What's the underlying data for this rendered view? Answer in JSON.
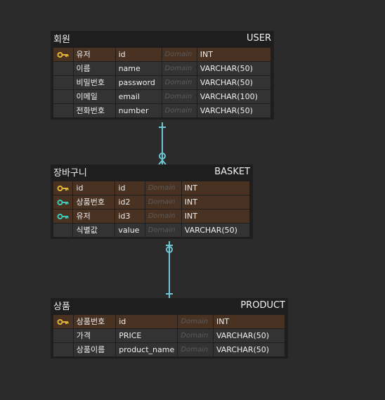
{
  "colors": {
    "pk_key": "#e5b53a",
    "fk_key": "#3ec9b8",
    "relation_line": "#6fc6d3"
  },
  "entities": {
    "user": {
      "logical_name": "회원",
      "physical_name": "USER",
      "rows": [
        {
          "key": "pk",
          "logical": "유저",
          "physical": "id",
          "domain": "Domain",
          "type": "INT"
        },
        {
          "key": "none",
          "logical": "이름",
          "physical": "name",
          "domain": "Domain",
          "type": "VARCHAR(50)"
        },
        {
          "key": "none",
          "logical": "비밀번호",
          "physical": "password",
          "domain": "Domain",
          "type": "VARCHAR(50)"
        },
        {
          "key": "none",
          "logical": "이메일",
          "physical": "email",
          "domain": "Domain",
          "type": "VARCHAR(100)"
        },
        {
          "key": "none",
          "logical": "전화번호",
          "physical": "number",
          "domain": "Domain",
          "type": "VARCHAR(50)"
        }
      ]
    },
    "basket": {
      "logical_name": "장바구니",
      "physical_name": "BASKET",
      "rows": [
        {
          "key": "pk",
          "logical": "id",
          "physical": "id",
          "domain": "Domain",
          "type": "INT"
        },
        {
          "key": "pfk",
          "logical": "상품번호",
          "physical": "id2",
          "domain": "Domain",
          "type": "INT"
        },
        {
          "key": "pfk",
          "logical": "유저",
          "physical": "id3",
          "domain": "Domain",
          "type": "INT"
        },
        {
          "key": "none",
          "logical": "식별값",
          "physical": "value",
          "domain": "Domain",
          "type": "VARCHAR(50)"
        }
      ]
    },
    "product": {
      "logical_name": "상품",
      "physical_name": "PRODUCT",
      "rows": [
        {
          "key": "pk",
          "logical": "상품번호",
          "physical": "id",
          "domain": "Domain",
          "type": "INT"
        },
        {
          "key": "none",
          "logical": "가격",
          "physical": "PRICE",
          "domain": "Domain",
          "type": "VARCHAR(50)"
        },
        {
          "key": "none",
          "logical": "상품이름",
          "physical": "product_name",
          "domain": "Domain",
          "type": "VARCHAR(50)"
        }
      ]
    }
  }
}
